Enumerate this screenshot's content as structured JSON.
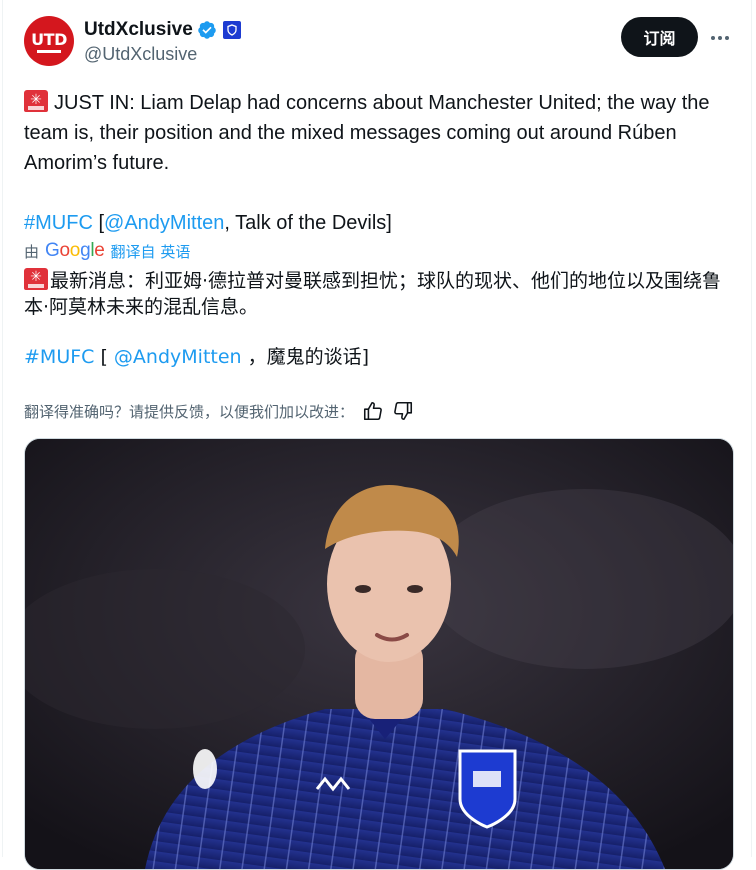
{
  "author": {
    "display_name": "UtdXclusive",
    "handle": "@UtdXclusive",
    "avatar_text": "UTD"
  },
  "actions": {
    "subscribe_label": "订阅",
    "more_icon": "more-horizontal-icon"
  },
  "tweet": {
    "line1_rest": "JUST IN: Liam Delap had concerns about Manchester United; the way the team is, their position and the mixed messages coming out around Rúben Amorim’s future.",
    "hashtag": "#MUFC",
    "bracket_open": "[",
    "mention": "@AndyMitten",
    "tail": ", Talk of the Devils]"
  },
  "translation": {
    "by_prefix": "由",
    "google": "Google",
    "translated_from": "翻译自 英语",
    "line1": "最新消息：利亚姆·德拉普对曼联感到担忧；球队的现状、他们的地位以及围绕鲁本·阿莫林未来的混乱信息。",
    "hashtag": "#MUFC",
    "bracket_open": "[ ",
    "mention": "@AndyMitten",
    "tail": " ，魔鬼的谈话]"
  },
  "feedback": {
    "prompt": "翻译得准确吗？请提供反馈，以便我们加以改进：",
    "thumb_up_icon": "thumbs-up-icon",
    "thumb_down_icon": "thumbs-down-icon"
  },
  "colors": {
    "link": "#1d9bf0",
    "text": "#0f1419",
    "muted": "#536471",
    "kit": "#1b2a8a"
  }
}
